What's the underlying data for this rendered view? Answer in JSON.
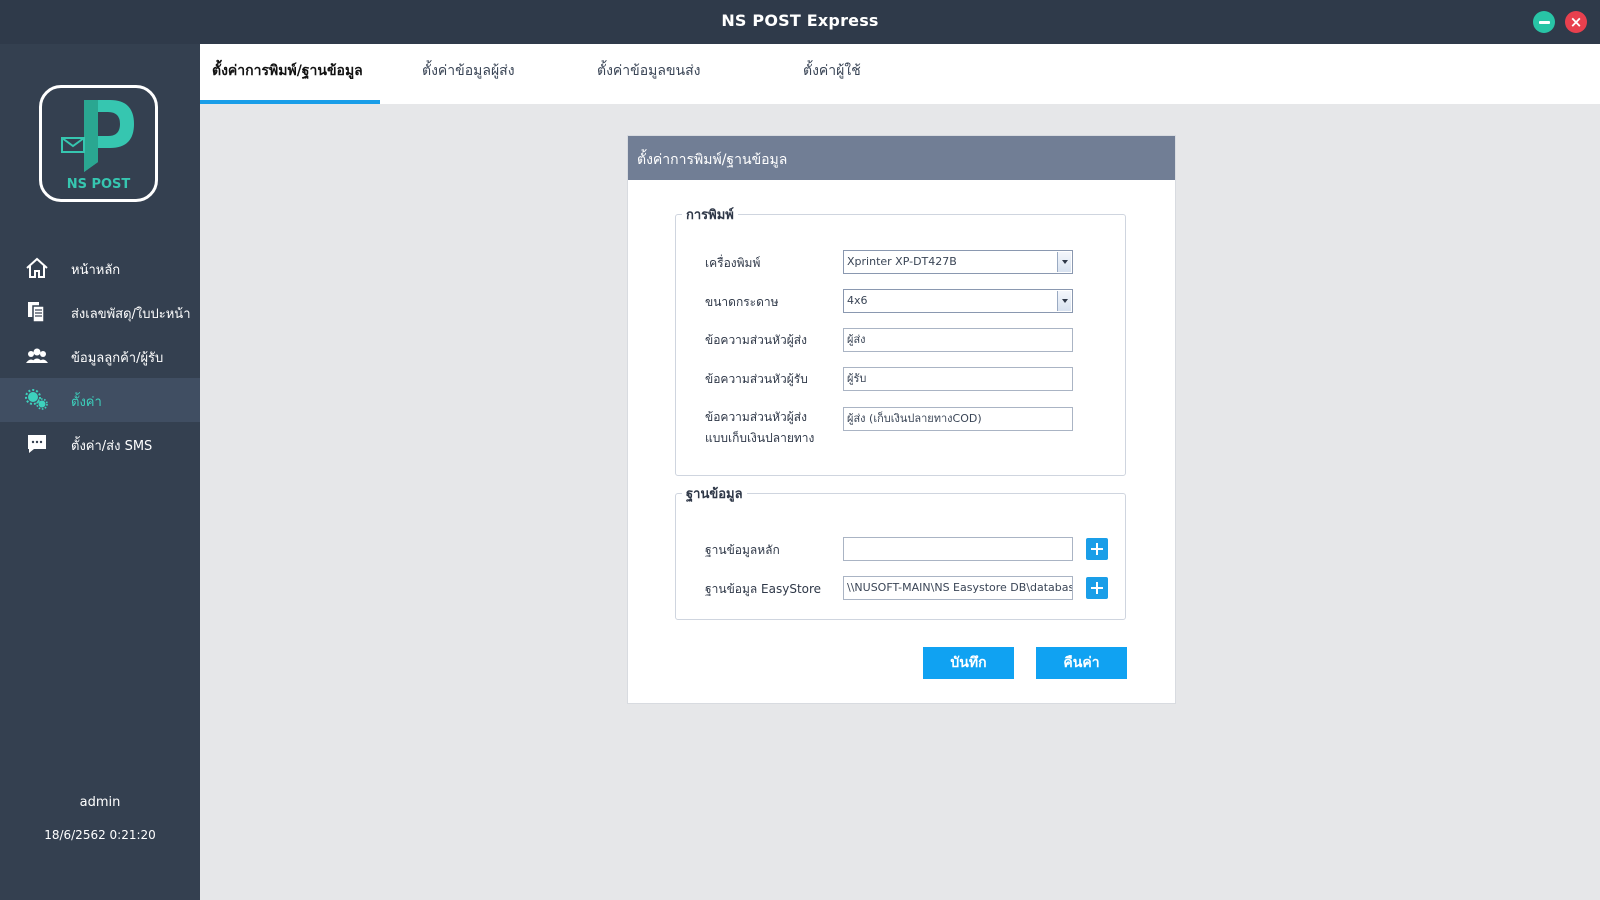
{
  "window": {
    "title": "NS POST Express",
    "minimize_icon": "minus-icon",
    "close_icon": "close-icon",
    "close_glyph": "×"
  },
  "sidebar": {
    "logo_text": "NS POST",
    "items": [
      {
        "label": "หน้าหลัก",
        "icon": "home-icon"
      },
      {
        "label": "ส่งเลขพัสดุ/ใบปะหน้า",
        "icon": "documents-icon"
      },
      {
        "label": "ข้อมูลลูกค้า/ผู้รับ",
        "icon": "users-icon"
      },
      {
        "label": "ตั้งค่า",
        "icon": "gears-icon",
        "active": true
      },
      {
        "label": "ตั้งค่า/ส่ง SMS",
        "icon": "chat-icon"
      }
    ],
    "user": "admin",
    "datetime": "18/6/2562 0:21:20"
  },
  "tabs": [
    {
      "label": "ตั้งค่าการพิมพ์/ฐานข้อมูล",
      "active": true
    },
    {
      "label": "ตั้งค่าข้อมูลผู้ส่ง"
    },
    {
      "label": "ตั้งค่าข้อมูลขนส่ง"
    },
    {
      "label": "ตั้งค่าผู้ใช้"
    }
  ],
  "panel": {
    "title": "ตั้งค่าการพิมพ์/ฐานข้อมูล",
    "print_group": {
      "legend": "การพิมพ์",
      "printer_label": "เครื่องพิมพ์",
      "printer_value": "Xprinter XP-DT427B",
      "paper_label": "ขนาดกระดาษ",
      "paper_value": "4x6",
      "sender_header_label": "ข้อความส่วนหัวผู้ส่ง",
      "sender_header_value": "ผู้ส่ง",
      "receiver_header_label": "ข้อความส่วนหัวผู้รับ",
      "receiver_header_value": "ผู้รับ",
      "cod_header_label_line1": "ข้อความส่วนหัวผู้ส่ง",
      "cod_header_label_line2": "แบบเก็บเงินปลายทาง",
      "cod_header_value": "ผู้ส่ง (เก็บเงินปลายทางCOD)"
    },
    "db_group": {
      "legend": "ฐานข้อมูล",
      "main_db_label": "ฐานข้อมูลหลัก",
      "main_db_value": "",
      "easystore_label": "ฐานข้อมูล EasyStore",
      "easystore_value": "\\\\NUSOFT-MAIN\\NS Easystore DB\\database"
    },
    "save_label": "บันทึก",
    "reset_label": "คืนค่า"
  },
  "colors": {
    "titlebar": "#2f3a4a",
    "sidebar": "#344050",
    "accent_teal": "#3dd1bd",
    "accent_blue": "#10a2f2",
    "panel_header": "#717e95"
  }
}
